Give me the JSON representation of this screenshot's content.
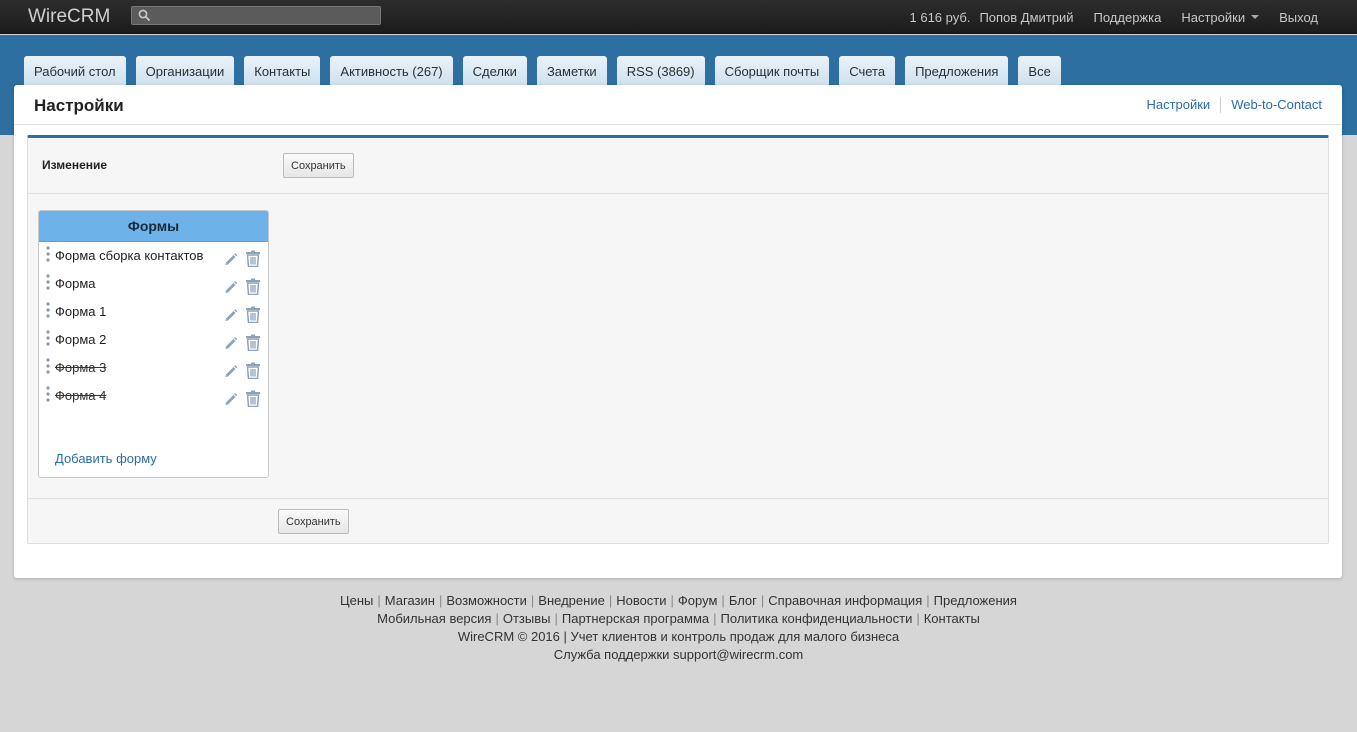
{
  "topbar": {
    "brand": "WireCRM",
    "search_placeholder": "",
    "balance": "1 616 руб.",
    "user": "Попов Дмитрий",
    "support": "Поддержка",
    "settings": "Настройки",
    "logout": "Выход"
  },
  "tabs": [
    {
      "label": "Рабочий стол"
    },
    {
      "label": "Организации"
    },
    {
      "label": "Контакты"
    },
    {
      "label": "Активность (267)"
    },
    {
      "label": "Сделки"
    },
    {
      "label": "Заметки"
    },
    {
      "label": "RSS (3869)"
    },
    {
      "label": "Сборщик почты"
    },
    {
      "label": "Счета"
    },
    {
      "label": "Предложения"
    },
    {
      "label": "Все"
    }
  ],
  "page": {
    "title": "Настройки",
    "links": {
      "settings": "Настройки",
      "web_to_contact": "Web-to-Contact"
    }
  },
  "panel": {
    "edit_label": "Изменение",
    "save_top": "Сохранить",
    "save_bottom": "Сохранить"
  },
  "forms": {
    "header": "Формы",
    "items": [
      {
        "name": "Форма сборка контактов",
        "struck": false
      },
      {
        "name": "Форма",
        "struck": false
      },
      {
        "name": "Форма 1",
        "struck": false
      },
      {
        "name": "Форма 2",
        "struck": false
      },
      {
        "name": "Форма 3",
        "struck": true
      },
      {
        "name": "Форма 4",
        "struck": true
      }
    ],
    "add_link": "Добавить форму"
  },
  "footer": {
    "line1": [
      "Цены",
      "Магазин",
      "Возможности",
      "Внедрение",
      "Новости",
      "Форум",
      "Блог",
      "Справочная информация",
      "Предложения"
    ],
    "line2": [
      "Мобильная версия",
      "Отзывы",
      "Партнерская программа",
      "Политика конфиденциальности",
      "Контакты"
    ],
    "line3": "WireCRM © 2016 | Учет клиентов и контроль продаж для малого бизнеса",
    "line4": "Служба поддержки support@wirecrm.com"
  },
  "colors": {
    "accent": "#2c6fa0",
    "forms_header": "#6db3ea",
    "link": "#2a6ca8"
  }
}
